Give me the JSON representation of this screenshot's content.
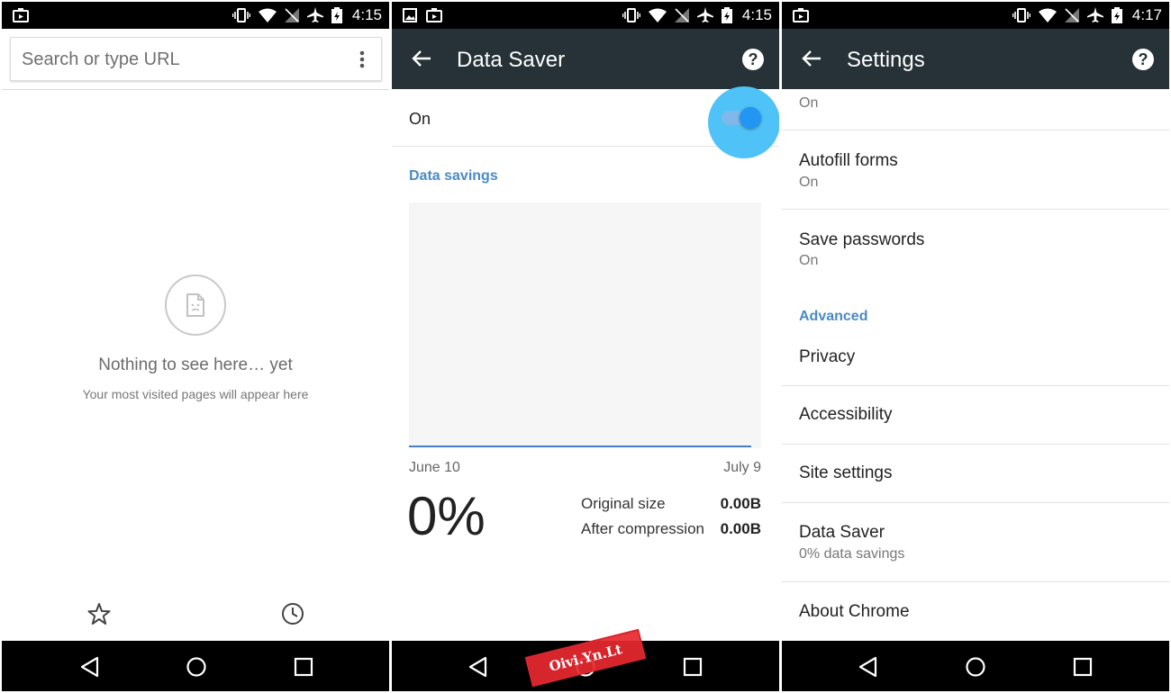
{
  "screen1": {
    "time": "4:15",
    "search_placeholder": "Search or type URL",
    "empty_title": "Nothing to see here… yet",
    "empty_subtitle": "Your most visited pages will appear here",
    "icons": [
      "bookmarks-star-icon",
      "history-clock-icon"
    ]
  },
  "screen2": {
    "time": "4:15",
    "title": "Data Saver",
    "toggle_label": "On",
    "toggle_on": true,
    "section_header": "Data savings",
    "date_start": "June 10",
    "date_end": "July 9",
    "savings_percent": "0%",
    "stats": [
      {
        "label": "Original size",
        "value": "0.00B"
      },
      {
        "label": "After compression",
        "value": "0.00B"
      }
    ],
    "watermark": "Oivi.Yn.Lt",
    "accent_color": "#2196f3"
  },
  "screen3": {
    "time": "4:17",
    "title": "Settings",
    "partial_item_sub": "On",
    "items": [
      {
        "title": "Autofill forms",
        "subtitle": "On"
      },
      {
        "title": "Save passwords",
        "subtitle": "On"
      }
    ],
    "advanced_header": "Advanced",
    "advanced_items": [
      {
        "title": "Privacy"
      },
      {
        "title": "Accessibility"
      },
      {
        "title": "Site settings"
      },
      {
        "title": "Data Saver",
        "subtitle": "0% data savings"
      },
      {
        "title": "About Chrome"
      }
    ]
  },
  "colors": {
    "toolbar": "#263238",
    "section_header": "#4a8ac7",
    "chart_line": "#4a80c4"
  }
}
